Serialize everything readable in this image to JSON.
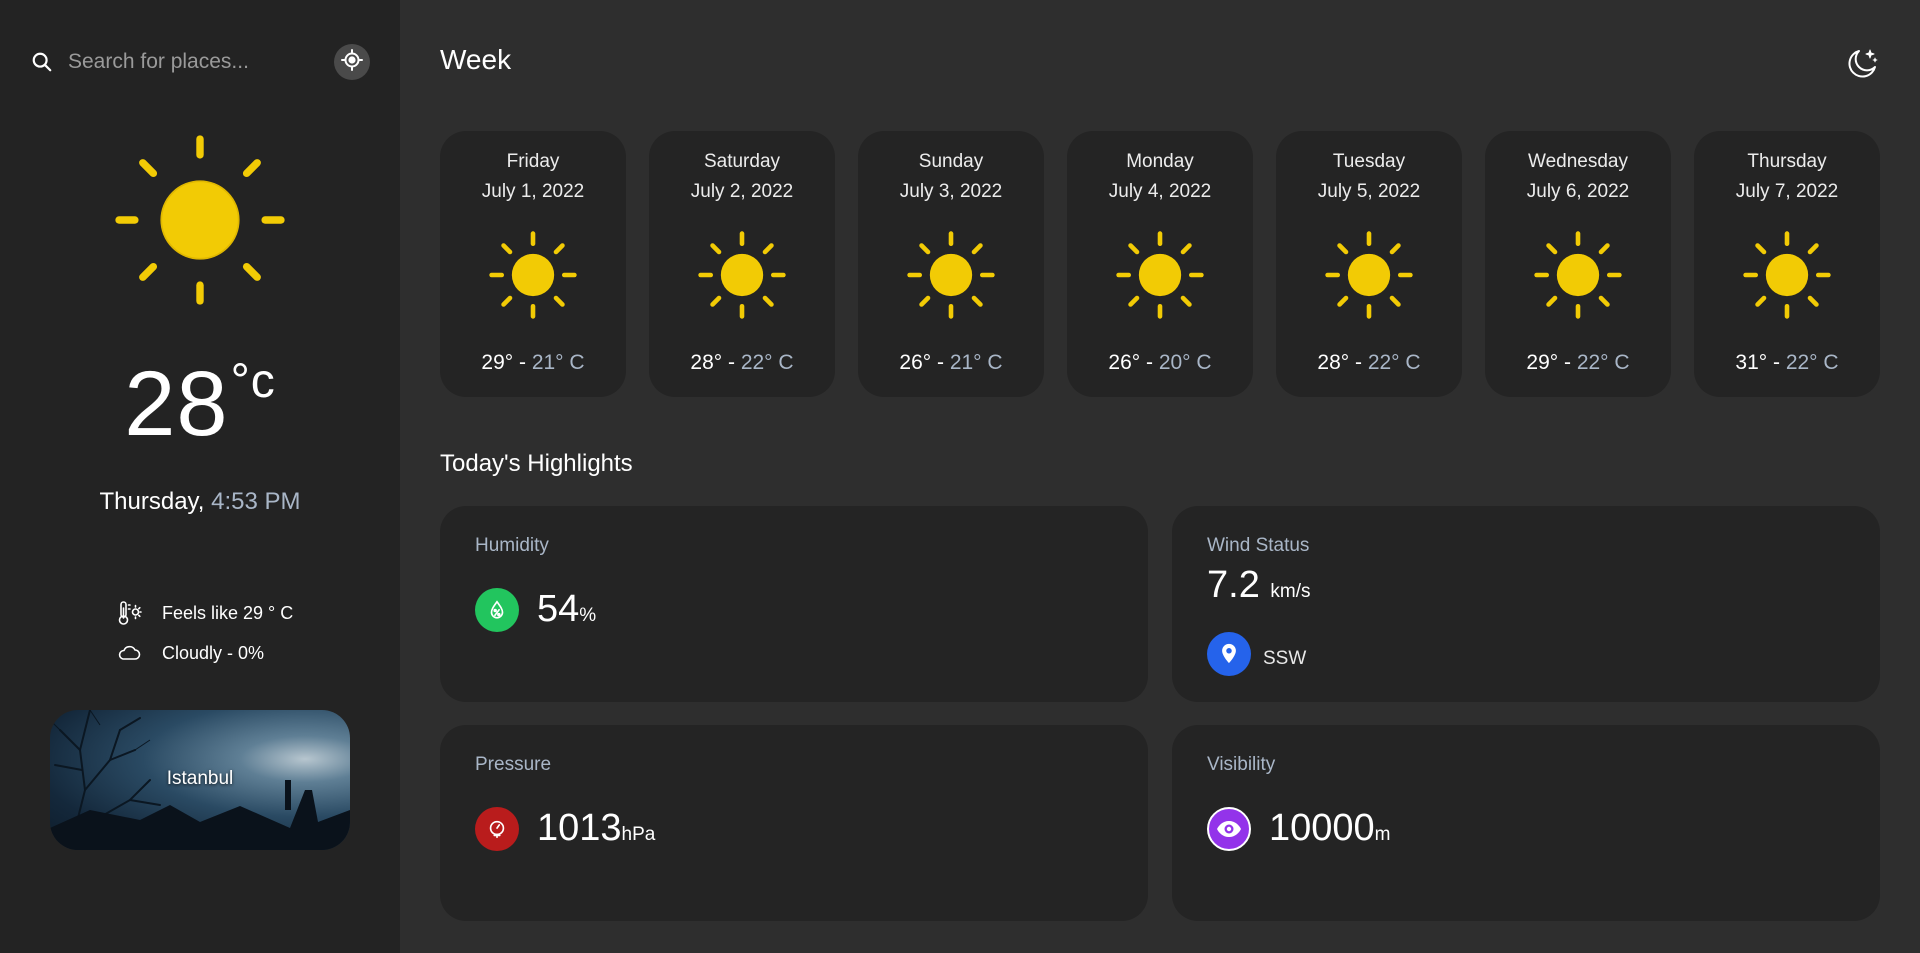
{
  "search": {
    "placeholder": "Search for places..."
  },
  "current": {
    "temperature": "28",
    "unit": "°c",
    "day": "Thursday,",
    "time": "4:53 PM",
    "feels_like": "Feels like 29 ° C",
    "cloud": "Cloudly - 0%",
    "city": "Istanbul",
    "icon": "sun-icon"
  },
  "week": {
    "title": "Week",
    "days": [
      {
        "name": "Friday",
        "date": "July 1, 2022",
        "hi": "29°",
        "lo": "21° C",
        "icon": "sun-icon"
      },
      {
        "name": "Saturday",
        "date": "July 2, 2022",
        "hi": "28°",
        "lo": "22° C",
        "icon": "sun-icon"
      },
      {
        "name": "Sunday",
        "date": "July 3, 2022",
        "hi": "26°",
        "lo": "21° C",
        "icon": "sun-icon"
      },
      {
        "name": "Monday",
        "date": "July 4, 2022",
        "hi": "26°",
        "lo": "20° C",
        "icon": "sun-icon"
      },
      {
        "name": "Tuesday",
        "date": "July 5, 2022",
        "hi": "28°",
        "lo": "22° C",
        "icon": "sun-icon"
      },
      {
        "name": "Wednesday",
        "date": "July 6, 2022",
        "hi": "29°",
        "lo": "22° C",
        "icon": "sun-icon"
      },
      {
        "name": "Thursday",
        "date": "July 7, 2022",
        "hi": "31°",
        "lo": "22° C",
        "icon": "sun-icon"
      }
    ]
  },
  "highlights": {
    "title": "Today's Highlights",
    "humidity": {
      "label": "Humidity",
      "value": "54",
      "unit": "%",
      "color": "#22c55e"
    },
    "wind": {
      "label": "Wind Status",
      "value": "7.2",
      "unit": "km/s",
      "direction": "SSW",
      "color": "#2563eb"
    },
    "pressure": {
      "label": "Pressure",
      "value": "1013",
      "unit": "hPa",
      "color": "#b91c1c"
    },
    "visibility": {
      "label": "Visibility",
      "value": "10000",
      "unit": "m",
      "color": "#9333ea"
    }
  },
  "colors": {
    "sun": "#f2cb05",
    "sidebar_bg": "#232323",
    "main_bg": "#2e2e2e",
    "card_bg": "#242424",
    "muted_text": "#a9b6c7"
  }
}
